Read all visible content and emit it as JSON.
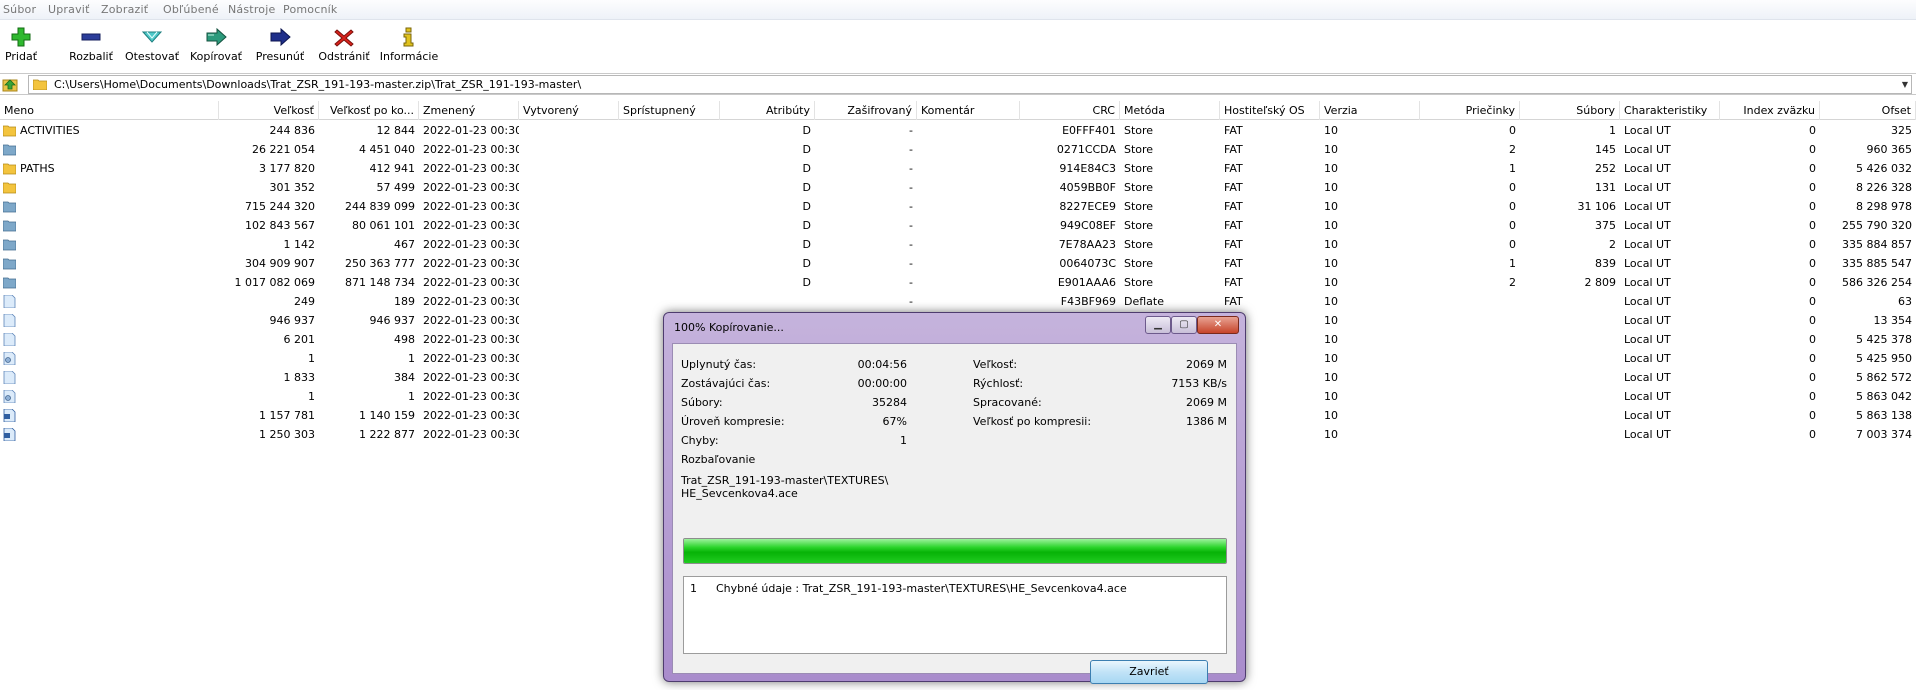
{
  "menu": [
    "Súbor",
    "Upraviť",
    "Zobraziť",
    "Obľúbené",
    "Nástroje",
    "Pomocník"
  ],
  "toolbar": [
    {
      "label": "Pridať",
      "icon": "add-icon"
    },
    {
      "label": "Rozbaliť",
      "icon": "extract-icon"
    },
    {
      "label": "Otestovať",
      "icon": "test-icon"
    },
    {
      "label": "Kopírovať",
      "icon": "copy-icon"
    },
    {
      "label": "Presunúť",
      "icon": "move-icon"
    },
    {
      "label": "Odstrániť",
      "icon": "delete-icon"
    },
    {
      "label": "Informácie",
      "icon": "info-icon"
    }
  ],
  "address": {
    "path": "C:\\Users\\Home\\Documents\\Downloads\\Trat_ZSR_191-193-master.zip\\Trat_ZSR_191-193-master\\"
  },
  "columns": [
    "Meno",
    "Veľkosť",
    "Veľkosť po ko...",
    "Zmenený",
    "Vytvorený",
    "Sprístupnený",
    "Atribúty",
    "Zašifrovaný",
    "Komentár",
    "CRC",
    "Metóda",
    "Hostiteľský OS",
    "Verzia",
    "Priečinky",
    "Súbory",
    "Charakteristiky",
    "Index zväzku",
    "Ofset"
  ],
  "rows": [
    {
      "name": "ACTIVITIES",
      "icon": "folder",
      "size": "244 836",
      "packed": "12 844",
      "modified": "2022-01-23 00:30",
      "attr": "D",
      "enc": "-",
      "crc": "E0FFF401",
      "method": "Store",
      "os": "FAT",
      "ver": "10",
      "folders": "0",
      "files": "1",
      "char": "Local UT",
      "vol": "0",
      "offset": "325"
    },
    {
      "name": "",
      "icon": "folder-blue",
      "size": "26 221 054",
      "packed": "4 451 040",
      "modified": "2022-01-23 00:30",
      "attr": "D",
      "enc": "-",
      "crc": "0271CCDA",
      "method": "Store",
      "os": "FAT",
      "ver": "10",
      "folders": "2",
      "files": "145",
      "char": "Local UT",
      "vol": "0",
      "offset": "960 365"
    },
    {
      "name": "PATHS",
      "icon": "folder",
      "size": "3 177 820",
      "packed": "412 941",
      "modified": "2022-01-23 00:30",
      "attr": "D",
      "enc": "-",
      "crc": "914E84C3",
      "method": "Store",
      "os": "FAT",
      "ver": "10",
      "folders": "1",
      "files": "252",
      "char": "Local UT",
      "vol": "0",
      "offset": "5 426 032"
    },
    {
      "name": "",
      "icon": "folder",
      "size": "301 352",
      "packed": "57 499",
      "modified": "2022-01-23 00:30",
      "attr": "D",
      "enc": "-",
      "crc": "4059BB0F",
      "method": "Store",
      "os": "FAT",
      "ver": "10",
      "folders": "0",
      "files": "131",
      "char": "Local UT",
      "vol": "0",
      "offset": "8 226 328"
    },
    {
      "name": "",
      "icon": "folder-blue",
      "size": "715 244 320",
      "packed": "244 839 099",
      "modified": "2022-01-23 00:30",
      "attr": "D",
      "enc": "-",
      "crc": "8227ECE9",
      "method": "Store",
      "os": "FAT",
      "ver": "10",
      "folders": "0",
      "files": "31 106",
      "char": "Local UT",
      "vol": "0",
      "offset": "8 298 978"
    },
    {
      "name": "",
      "icon": "folder-blue",
      "size": "102 843 567",
      "packed": "80 061 101",
      "modified": "2022-01-23 00:30",
      "attr": "D",
      "enc": "-",
      "crc": "949C08EF",
      "method": "Store",
      "os": "FAT",
      "ver": "10",
      "folders": "0",
      "files": "375",
      "char": "Local UT",
      "vol": "0",
      "offset": "255 790 320"
    },
    {
      "name": "",
      "icon": "folder-blue",
      "size": "1 142",
      "packed": "467",
      "modified": "2022-01-23 00:30",
      "attr": "D",
      "enc": "-",
      "crc": "7E78AA23",
      "method": "Store",
      "os": "FAT",
      "ver": "10",
      "folders": "0",
      "files": "2",
      "char": "Local UT",
      "vol": "0",
      "offset": "335 884 857"
    },
    {
      "name": "",
      "icon": "folder-blue",
      "size": "304 909 907",
      "packed": "250 363 777",
      "modified": "2022-01-23 00:30",
      "attr": "D",
      "enc": "-",
      "crc": "0064073C",
      "method": "Store",
      "os": "FAT",
      "ver": "10",
      "folders": "1",
      "files": "839",
      "char": "Local UT",
      "vol": "0",
      "offset": "335 885 547"
    },
    {
      "name": "",
      "icon": "folder-blue",
      "size": "1 017 082 069",
      "packed": "871 148 734",
      "modified": "2022-01-23 00:30",
      "attr": "D",
      "enc": "-",
      "crc": "E901AAA6",
      "method": "Store",
      "os": "FAT",
      "ver": "10",
      "folders": "2",
      "files": "2 809",
      "char": "Local UT",
      "vol": "0",
      "offset": "586 326 254"
    },
    {
      "name": "",
      "icon": "file",
      "size": "249",
      "packed": "189",
      "modified": "2022-01-23 00:30",
      "attr": "",
      "enc": "-",
      "crc": "F43BF969",
      "method": "Deflate",
      "os": "FAT",
      "ver": "10",
      "folders": "",
      "files": "",
      "char": "Local UT",
      "vol": "0",
      "offset": "63"
    },
    {
      "name": "",
      "icon": "file",
      "size": "946 937",
      "packed": "946 937",
      "modified": "2022-01-23 00:30",
      "attr": "",
      "enc": "",
      "crc": "",
      "method": "",
      "os": "",
      "ver": "10",
      "folders": "",
      "files": "",
      "char": "Local UT",
      "vol": "0",
      "offset": "13 354"
    },
    {
      "name": "",
      "icon": "file",
      "size": "6 201",
      "packed": "498",
      "modified": "2022-01-23 00:30",
      "attr": "",
      "enc": "",
      "crc": "",
      "method": "",
      "os": "",
      "ver": "10",
      "folders": "",
      "files": "",
      "char": "Local UT",
      "vol": "0",
      "offset": "5 425 378"
    },
    {
      "name": "",
      "icon": "file-gear",
      "size": "1",
      "packed": "1",
      "modified": "2022-01-23 00:30",
      "attr": "",
      "enc": "",
      "crc": "",
      "method": "",
      "os": "",
      "ver": "10",
      "folders": "",
      "files": "",
      "char": "Local UT",
      "vol": "0",
      "offset": "5 425 950"
    },
    {
      "name": "",
      "icon": "file",
      "size": "1 833",
      "packed": "384",
      "modified": "2022-01-23 00:30",
      "attr": "",
      "enc": "",
      "crc": "",
      "method": "",
      "os": "",
      "ver": "10",
      "folders": "",
      "files": "",
      "char": "Local UT",
      "vol": "0",
      "offset": "5 862 572"
    },
    {
      "name": "",
      "icon": "file-gear",
      "size": "1",
      "packed": "1",
      "modified": "2022-01-23 00:30",
      "attr": "",
      "enc": "",
      "crc": "",
      "method": "",
      "os": "",
      "ver": "10",
      "folders": "",
      "files": "",
      "char": "Local UT",
      "vol": "0",
      "offset": "5 863 042"
    },
    {
      "name": "",
      "icon": "file-doc",
      "size": "1 157 781",
      "packed": "1 140 159",
      "modified": "2022-01-23 00:30",
      "attr": "",
      "enc": "",
      "crc": "",
      "method": "",
      "os": "",
      "ver": "10",
      "folders": "",
      "files": "",
      "char": "Local UT",
      "vol": "0",
      "offset": "5 863 138"
    },
    {
      "name": "",
      "icon": "file-doc",
      "size": "1 250 303",
      "packed": "1 222 877",
      "modified": "2022-01-23 00:30",
      "attr": "",
      "enc": "",
      "crc": "",
      "method": "",
      "os": "",
      "ver": "10",
      "folders": "",
      "files": "",
      "char": "Local UT",
      "vol": "0",
      "offset": "7 003 374"
    }
  ],
  "dialog": {
    "title": "100% Kopírovanie...",
    "elapsed_label": "Uplynutý čas:",
    "elapsed": "00:04:56",
    "remaining_label": "Zostávajúci čas:",
    "remaining": "00:00:00",
    "files_label": "Súbory:",
    "files": "35284",
    "ratio_label": "Úroveň kompresie:",
    "ratio": "67%",
    "errors_label": "Chyby:",
    "errors": "1",
    "size_label": "Veľkosť:",
    "size": "2069 M",
    "speed_label": "Rýchlosť:",
    "speed": "7153 KB/s",
    "processed_label": "Spracované:",
    "processed": "2069 M",
    "packed_label": "Veľkosť po kompresii:",
    "packed": "1386 M",
    "status": "Rozbaľovanie",
    "current_path_1": "Trat_ZSR_191-193-master\\TEXTURES\\",
    "current_path_2": "HE_Sevcenkova4.ace",
    "progress": 1.0,
    "log": [
      {
        "num": "1",
        "text": "Chybné údaje : Trat_ZSR_191-193-master\\TEXTURES\\HE_Sevcenkova4.ace"
      }
    ],
    "close_label": "Zavrieť"
  },
  "colors": {
    "progress": "#14c514",
    "dialog_frame": "#b49fd2",
    "folder": "#f3c43e",
    "folder_blue": "#7ea8c9"
  }
}
